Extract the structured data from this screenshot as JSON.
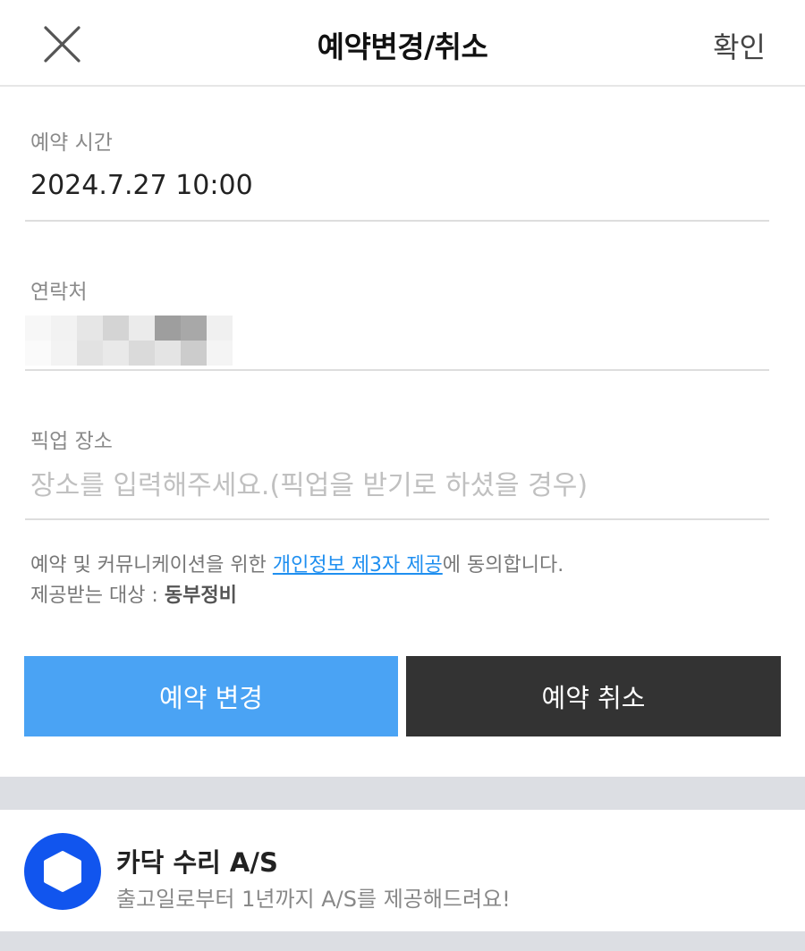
{
  "header": {
    "title": "예약변경/취소",
    "confirm_label": "확인"
  },
  "reservation_time": {
    "label": "예약 시간",
    "value": "2024.7.27 10:00"
  },
  "contact": {
    "label": "연락처"
  },
  "pickup": {
    "label": "픽업 장소",
    "placeholder": "장소를 입력해주세요.(픽업을 받기로 하셨을 경우)",
    "value": ""
  },
  "consent": {
    "prefix": "예약 및 커뮤니케이션을 위한 ",
    "link": "개인정보 제3자 제공",
    "suffix": "에 동의합니다.",
    "recipient_label": "제공받는 대상 : ",
    "recipient": "동부정비"
  },
  "buttons": {
    "change_label": "예약 변경",
    "cancel_label": "예약 취소"
  },
  "banner": {
    "title": "카닥 수리 A/S",
    "subtitle": "출고일로부터 1년까지 A/S를 제공해드려요!"
  },
  "colors": {
    "accent_blue": "#4aa3f4",
    "dark_button": "#333333",
    "link": "#1f8ff0",
    "logo_blue": "#1155ee"
  },
  "icons": {
    "close": "close-icon",
    "logo": "hexagon-logo-icon"
  }
}
